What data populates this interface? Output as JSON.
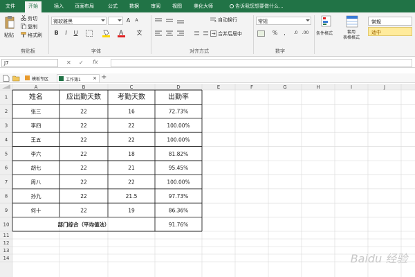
{
  "ribbon_tabs": [
    {
      "label": "文件",
      "active": false
    },
    {
      "label": "开始",
      "active": true
    },
    {
      "label": "插入",
      "active": false
    },
    {
      "label": "页面布局",
      "active": false
    },
    {
      "label": "公式",
      "active": false
    },
    {
      "label": "数据",
      "active": false
    },
    {
      "label": "审阅",
      "active": false
    },
    {
      "label": "视图",
      "active": false
    },
    {
      "label": "美化大师",
      "active": false
    }
  ],
  "tell_me": "告诉我您想要做什么...",
  "clipboard": {
    "paste": "粘贴",
    "cut": "剪切",
    "copy": "复制",
    "format_painter": "格式刷",
    "group": "剪贴板"
  },
  "font": {
    "name": "微软雅黑",
    "bold": "B",
    "italic": "I",
    "underline": "U",
    "group": "字体"
  },
  "alignment": {
    "wrap_text": "自动换行",
    "merge_center": "合并后居中",
    "group": "对齐方式"
  },
  "number": {
    "format": "常规",
    "percent": "%",
    "comma": ",",
    "group": "数字"
  },
  "styles": {
    "conditional_formatting": "条件格式",
    "format_as_table": "套用\n表格格式",
    "style_normal": "常规",
    "style_neutral": "适中"
  },
  "formula_bar": {
    "name_box": "J7",
    "cancel": "✕",
    "enter": "✓",
    "fx": "fx"
  },
  "workbook_tabs": [
    {
      "label": "模板专区",
      "active": false
    },
    {
      "label": "工作簿1",
      "active": true
    }
  ],
  "colors": {
    "excel_green": "#217346",
    "font_color_red": "#e02020",
    "fill_yellow": "#ffd800",
    "neutral_style": "#ffeb9c"
  },
  "sheet": {
    "columns": [
      "A",
      "B",
      "C",
      "D",
      "E",
      "F",
      "G",
      "H",
      "I",
      "J",
      "K"
    ],
    "row_numbers": [
      "1",
      "2",
      "3",
      "4",
      "5",
      "6",
      "7",
      "8",
      "9",
      "10",
      "11",
      "12",
      "13",
      "14"
    ],
    "headers": [
      "姓名",
      "应出勤天数",
      "考勤天数",
      "出勤率"
    ],
    "rows": [
      [
        "张三",
        "22",
        "16",
        "72.73%"
      ],
      [
        "李四",
        "22",
        "22",
        "100.00%"
      ],
      [
        "王五",
        "22",
        "22",
        "100.00%"
      ],
      [
        "李六",
        "22",
        "18",
        "81.82%"
      ],
      [
        "胡七",
        "22",
        "21",
        "95.45%"
      ],
      [
        "周八",
        "22",
        "22",
        "100.00%"
      ],
      [
        "孙九",
        "22",
        "21.5",
        "97.73%"
      ],
      [
        "何十",
        "22",
        "19",
        "86.36%"
      ]
    ],
    "summary": {
      "label": "部门综合（平均值法）",
      "value": "91.76%"
    }
  },
  "watermark": "Baidu 经验"
}
